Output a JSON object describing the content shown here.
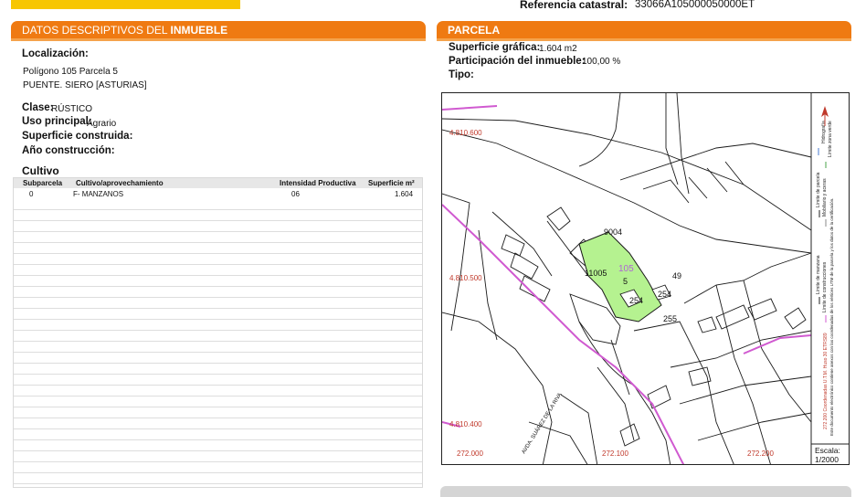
{
  "header": {
    "ref_label": "Referencia catastral:",
    "ref_value": "33066A105000050000ET"
  },
  "left_section": {
    "title_normal": "DATOS DESCRIPTIVOS DEL ",
    "title_bold": "INMUEBLE",
    "localizacion_label": "Localización:",
    "localizacion_line1": "Polígono 105 Parcela 5",
    "localizacion_line2": "PUENTE. SIERO [ASTURIAS]",
    "clase_label": "Clase:",
    "clase_value": "RÚSTICO",
    "uso_label": "Uso principal:",
    "uso_value": "Agrario",
    "superficie_label": "Superficie construida:",
    "anio_label": "Año construcción:",
    "cultivo_title": "Cultivo",
    "table": {
      "columns": [
        "Subparcela",
        "Cultivo/aprovechamiento",
        "Intensidad Productiva",
        "Superficie m²"
      ],
      "rows": [
        {
          "subparcela": "0",
          "cultivo": "F- MANZANOS",
          "intensidad": "06",
          "superficie": "1.604"
        }
      ]
    }
  },
  "right_section": {
    "title": "PARCELA",
    "sup_grafica_label": "Superficie gráfica:",
    "sup_grafica_value": "1.604 m2",
    "participacion_label": "Participación del inmueble:",
    "participacion_value": "100,00 %",
    "tipo_label": "Tipo:"
  },
  "map": {
    "parcel_number": "105",
    "labels": {
      "l9004": "9004",
      "l11005": "11005",
      "l5": "5",
      "l49": "49",
      "l254a": "254",
      "l254b": "254",
      "l255": "255"
    },
    "y_coords": [
      "4.810.600",
      "4.810.500",
      "4.810.400"
    ],
    "x_coords": [
      "272.000",
      "272.100",
      "272.200"
    ],
    "road_label": "AVDA. SUÁREZ DE LA RIVA",
    "legend_items": [
      "Hidrografía",
      "Límite zona verde",
      "Límite de parcela",
      "Mobiliario y aceras",
      "Límite de manzana",
      "Límite de construcciones"
    ],
    "note_line1": "272.200 Coordenadas U.T.M. Huso 30 ETRS89",
    "note_line2": "Este documento electrónico contiene anexos con las coordenadas de los vértices UTM de la parcela y los datos de la certificación.",
    "scale_label": "Escala:",
    "scale_value": "1/2000",
    "colors": {
      "parcel_fill": "#b5f290",
      "municipal_line": "#d05ad0",
      "coord_text": "#c0392b"
    }
  },
  "colors": {
    "accent": "#ef7a12",
    "brand_yellow": "#f7c600"
  }
}
